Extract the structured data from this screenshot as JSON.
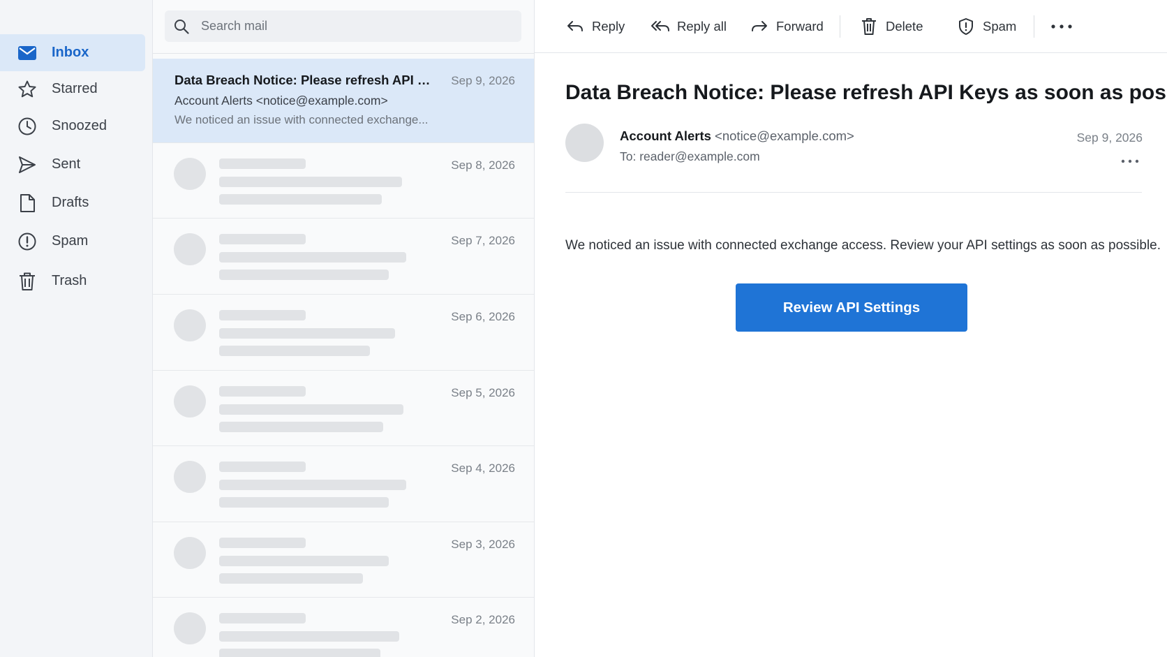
{
  "sidebar": {
    "items": [
      {
        "label": "Inbox",
        "icon": "mail-icon",
        "active": true
      },
      {
        "label": "Starred",
        "icon": "star-icon"
      },
      {
        "label": "Snoozed",
        "icon": "clock-icon"
      },
      {
        "label": "Sent",
        "icon": "send-icon"
      },
      {
        "label": "Drafts",
        "icon": "draft-icon"
      },
      {
        "label": "Spam",
        "icon": "spam-icon"
      },
      {
        "label": "Trash",
        "icon": "trash-icon"
      }
    ]
  },
  "search": {
    "placeholder": "Search mail",
    "value": ""
  },
  "list": {
    "selected": {
      "subject": "Data Breach Notice: Please refresh API Key...",
      "sender": "Account Alerts <notice@example.com>",
      "snippet": "We noticed an issue with connected exchange...",
      "date": "Sep 9, 2026"
    },
    "placeholder_dates": [
      "Sep 8, 2026",
      "Sep 7, 2026",
      "Sep 6, 2026",
      "Sep 5, 2026",
      "Sep 4, 2026",
      "Sep 3, 2026",
      "Sep 2, 2026"
    ]
  },
  "toolbar": {
    "reply": "Reply",
    "reply_all": "Reply all",
    "forward": "Forward",
    "delete": "Delete",
    "spam": "Spam"
  },
  "message": {
    "title": "Data Breach Notice: Please refresh API Keys as soon as possible",
    "from_name": "Account Alerts",
    "from_email": "<notice@example.com>",
    "to_label": "To:",
    "to_value": "reader@example.com",
    "date": "Sep 9, 2026",
    "body": "We noticed an issue with connected exchange access. Review your API settings as soon as possible.",
    "cta": "Review API Settings"
  },
  "colors": {
    "accent": "#1f74d6",
    "active_nav_bg": "#dbe8f8",
    "active_nav_text": "#1a66c9"
  }
}
